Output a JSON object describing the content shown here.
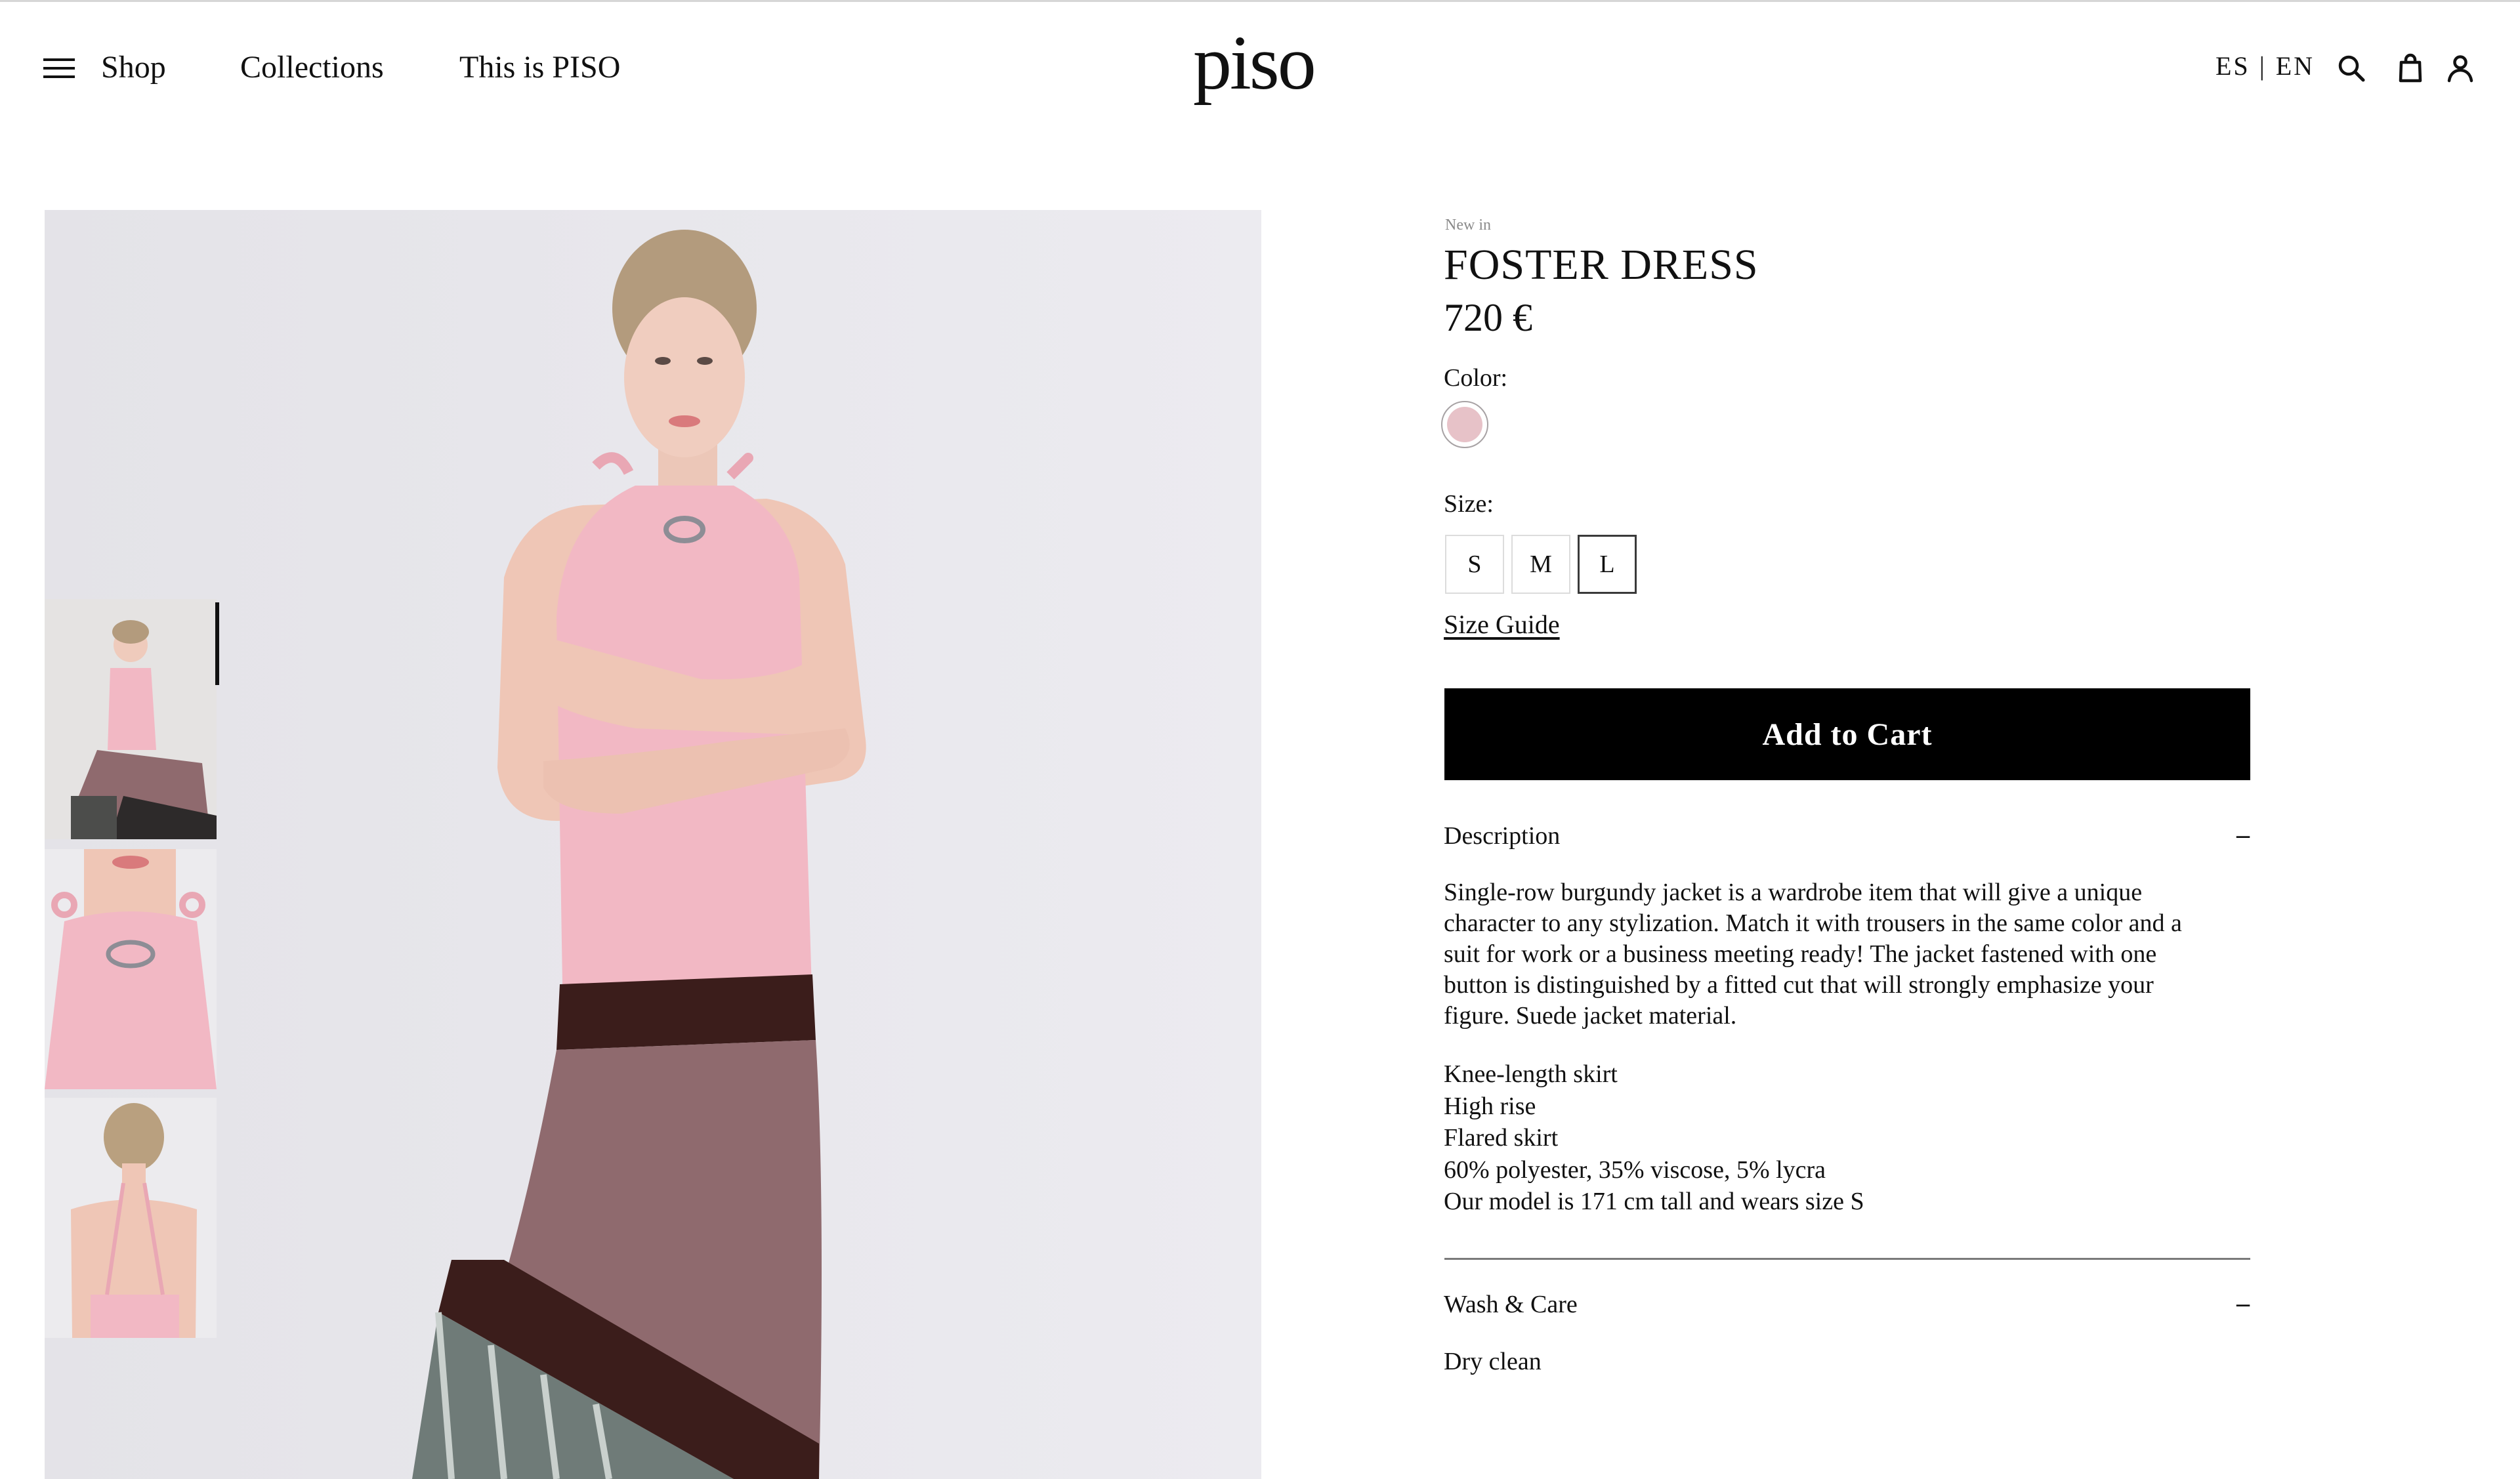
{
  "header": {
    "nav": [
      {
        "label": "Shop"
      },
      {
        "label": "Collections"
      },
      {
        "label": "This is PISO"
      }
    ],
    "logo": "piso",
    "languages": [
      "ES",
      "EN"
    ],
    "language_separator": "|",
    "icons": [
      "menu-icon",
      "search-icon",
      "bag-icon",
      "user-icon"
    ]
  },
  "gallery": {
    "thumbnail_count": 3,
    "selected_thumbnail": 1
  },
  "product": {
    "badge": "New in",
    "name": "FOSTER DRESS",
    "price": "720 €",
    "color_label": "Color:",
    "colors": [
      {
        "hex": "#e7c2c8",
        "selected": true
      }
    ],
    "size_label": "Size:",
    "sizes": [
      {
        "label": "S",
        "selected": false
      },
      {
        "label": "M",
        "selected": false
      },
      {
        "label": "L",
        "selected": true
      }
    ],
    "size_guide": "Size Guide",
    "add_to_cart": "Add to Cart",
    "description_title": "Description",
    "description_toggle": "–",
    "description": "Single-row burgundy jacket is a wardrobe item that will give a unique character to any stylization. Match it with trousers in the same color and a suit for work or a business meeting ready! The jacket fastened with one button is distinguished by a fitted cut that will strongly emphasize your figure. Suede jacket material.",
    "features": [
      "Knee-length skirt",
      "High rise",
      "Flared skirt",
      "60% polyester, 35% viscose, 5% lycra",
      "Our model is 171 cm tall and wears size S"
    ],
    "care_title": "Wash & Care",
    "care_toggle": "–",
    "care": "Dry clean"
  },
  "colors": {
    "background": "#ffffff",
    "text": "#111111",
    "button": "#000000",
    "button_text": "#ffffff",
    "photo_backdrop": "#e9e8ed",
    "dress_top": "#f2b8c4",
    "dress_skirt": "#8f6a6e",
    "dress_band": "#3b1d1b"
  }
}
